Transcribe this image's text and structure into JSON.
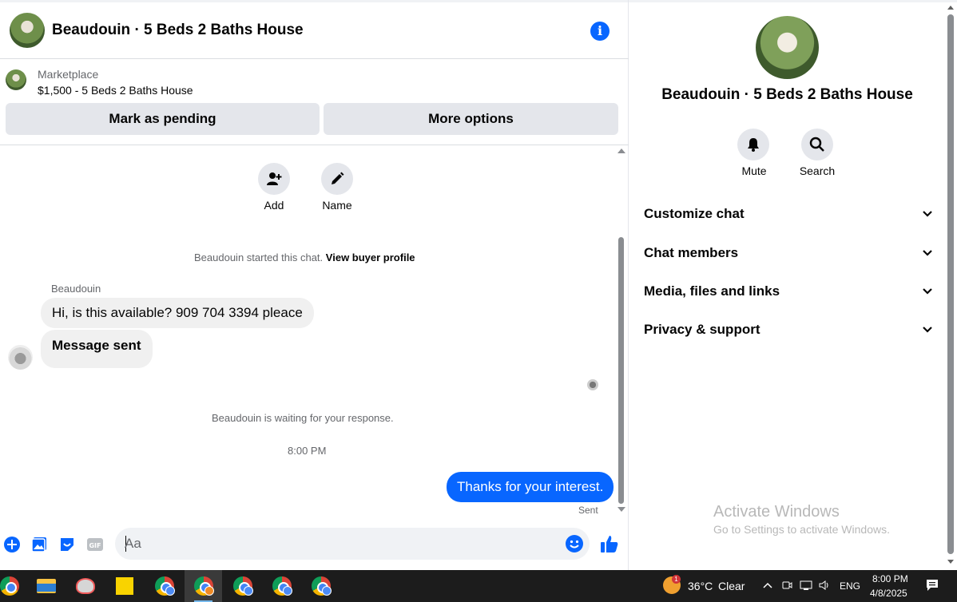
{
  "chat_header": {
    "title": "Beaudouin · 5 Beds 2 Baths House",
    "info_icon": "info-icon"
  },
  "marketplace": {
    "label": "Marketplace",
    "listing": "$1,500 - 5 Beds 2 Baths House",
    "mark_pending_label": "Mark as pending",
    "more_options_label": "More options"
  },
  "chat_actions": {
    "add_label": "Add",
    "name_label": "Name"
  },
  "messages": {
    "started_text": "Beaudouin started this chat.",
    "view_profile_link": "View buyer profile",
    "sender_name": "Beaudouin",
    "incoming": [
      "Hi, is this available? 909 704 3394 pleace",
      "Message sent"
    ],
    "waiting_text": "Beaudouin is waiting for your response.",
    "timestamp": "8:00 PM",
    "outgoing": "Thanks for your interest.",
    "status": "Sent"
  },
  "composer": {
    "placeholder": "Aa",
    "icons": [
      "plus-icon",
      "photo-icon",
      "sticker-icon",
      "gif-icon",
      "emoji-icon",
      "like-icon"
    ],
    "gif_text": "GIF"
  },
  "info_pane": {
    "title": "Beaudouin · 5 Beds 2 Baths House",
    "mute_label": "Mute",
    "search_label": "Search",
    "sections": [
      "Customize chat",
      "Chat members",
      "Media, files and links",
      "Privacy & support"
    ]
  },
  "watermark": {
    "line1": "Activate Windows",
    "line2": "Go to Settings to activate Windows."
  },
  "taskbar": {
    "weather_badge": "1",
    "temperature": "36°C",
    "condition": "Clear",
    "language": "ENG",
    "time": "8:00 PM",
    "date": "4/8/2025"
  },
  "colors": {
    "accent": "#0866ff",
    "bubble_in": "#f0f0f0",
    "button_gray": "#e4e6eb",
    "taskbar": "#1c1c1c"
  }
}
